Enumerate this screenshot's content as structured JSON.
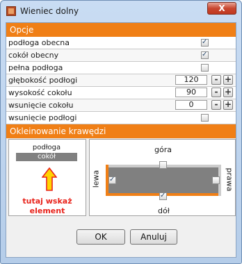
{
  "window": {
    "title": "Wieniec dolny",
    "close_label": "X"
  },
  "options": {
    "header": "Opcje",
    "rows": [
      {
        "label": "podłoga obecna",
        "checked": true
      },
      {
        "label": "cokół obecny",
        "checked": true
      },
      {
        "label": "pełna podłoga",
        "checked": false
      },
      {
        "label": "głębokość podłogi",
        "value": "120",
        "minus": "-",
        "plus": "+"
      },
      {
        "label": "wysokość cokołu",
        "value": "90",
        "minus": "-",
        "plus": "+"
      },
      {
        "label": "wsunięcie cokołu",
        "value": "0",
        "minus": "-",
        "plus": "+"
      },
      {
        "label": "wsunięcie podłogi",
        "checked": false
      }
    ]
  },
  "edging": {
    "header": "Okleinowanie krawędzi",
    "elements": [
      "podłoga",
      "cokół"
    ],
    "selected": "cokół",
    "hint_line1": "tutaj wskaż",
    "hint_line2": "element",
    "top_label": "góra",
    "bottom_label": "dół",
    "left_label": "lewa",
    "right_label": "prawa",
    "top_checked": false,
    "bottom_checked": true,
    "left_checked": true,
    "right_checked": false
  },
  "buttons": {
    "ok": "OK",
    "cancel": "Anuluj"
  },
  "colors": {
    "accent": "#f07f16",
    "hint": "#e8231b",
    "arrow": "#ffd400"
  }
}
